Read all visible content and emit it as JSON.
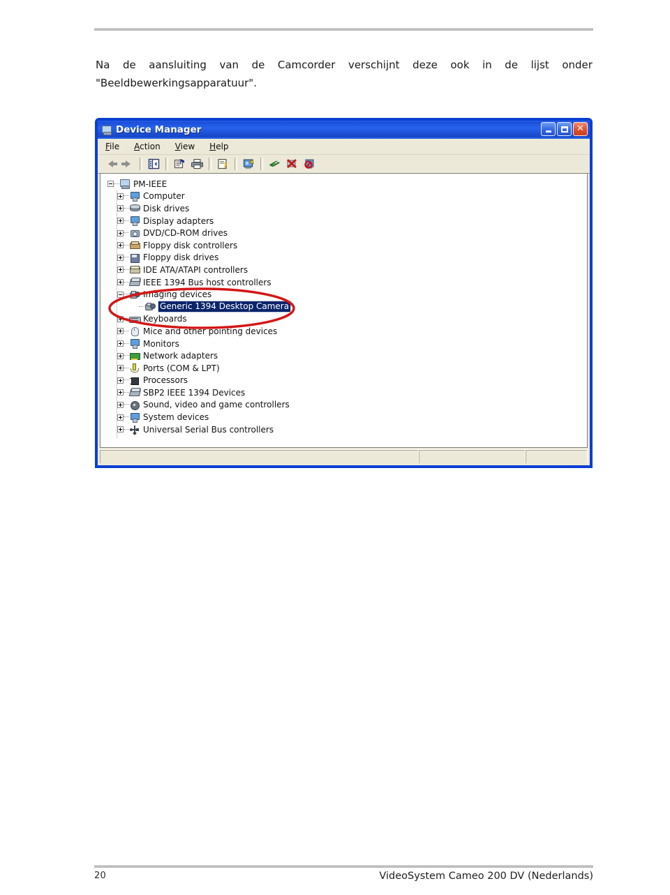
{
  "document": {
    "intro_line1_words": [
      "Na",
      "de",
      "aansluiting",
      "van",
      "de",
      "Camcorder",
      "verschijnt",
      "deze",
      "ook",
      "in",
      "de",
      "lijst",
      "onder"
    ],
    "intro_line2": "\"Beeldbewerkingsapparatuur\".",
    "footer_page_number": "20",
    "footer_title": "VideoSystem Cameo 200 DV (Nederlands)"
  },
  "window": {
    "title": "Device Manager",
    "buttons": {
      "minimize": "_",
      "maximize": "□",
      "close": "✕"
    },
    "menu": [
      {
        "pre": "",
        "accel": "F",
        "post": "ile"
      },
      {
        "pre": "",
        "accel": "A",
        "post": "ction"
      },
      {
        "pre": "",
        "accel": "V",
        "post": "iew"
      },
      {
        "pre": "",
        "accel": "H",
        "post": "elp"
      }
    ],
    "toolbar": [
      {
        "name": "back-button",
        "icon": "arrow-left"
      },
      {
        "name": "forward-button",
        "icon": "arrow-right"
      },
      {
        "name": "show-hide-console-tree-button",
        "icon": "console-tree"
      },
      {
        "name": "properties-button",
        "icon": "properties"
      },
      {
        "name": "print-button",
        "icon": "printer"
      },
      {
        "name": "help-button",
        "icon": "help"
      },
      {
        "name": "scan-for-hardware-changes-button",
        "icon": "scan-hardware"
      },
      {
        "name": "update-driver-button",
        "icon": "update-driver"
      },
      {
        "name": "uninstall-button",
        "icon": "uninstall"
      },
      {
        "name": "disable-button",
        "icon": "disable"
      }
    ],
    "statusbar": {
      "panel1": "",
      "panel2": "",
      "panel3": ""
    }
  },
  "tree": {
    "root": {
      "label": "PM-IEEE",
      "icon": "computer-icon",
      "state": "expanded"
    },
    "nodes": [
      {
        "label": "Computer",
        "icon": "monitor-icon",
        "state": "collapsed",
        "level": 1
      },
      {
        "label": "Disk drives",
        "icon": "disk-icon",
        "state": "collapsed",
        "level": 1
      },
      {
        "label": "Display adapters",
        "icon": "monitor-icon",
        "state": "collapsed",
        "level": 1
      },
      {
        "label": "DVD/CD-ROM drives",
        "icon": "cdrom-icon",
        "state": "collapsed",
        "level": 1
      },
      {
        "label": "Floppy disk controllers",
        "icon": "floppy-controller-icon",
        "state": "collapsed",
        "level": 1
      },
      {
        "label": "Floppy disk drives",
        "icon": "floppy-drive-icon",
        "state": "collapsed",
        "level": 1
      },
      {
        "label": "IDE ATA/ATAPI controllers",
        "icon": "ide-controller-icon",
        "state": "collapsed",
        "level": 1
      },
      {
        "label": "IEEE 1394 Bus host controllers",
        "icon": "firewire-icon",
        "state": "collapsed",
        "level": 1
      },
      {
        "label": "Imaging devices",
        "icon": "camera-icon",
        "state": "expanded",
        "level": 1
      },
      {
        "label": "Generic 1394 Desktop Camera",
        "icon": "camera-icon",
        "state": "leaf",
        "level": 2,
        "selected": true
      },
      {
        "label": "Keyboards",
        "icon": "keyboard-icon",
        "state": "collapsed",
        "level": 1
      },
      {
        "label": "Mice and other pointing devices",
        "icon": "mouse-icon",
        "state": "collapsed",
        "level": 1
      },
      {
        "label": "Monitors",
        "icon": "monitor-icon",
        "state": "collapsed",
        "level": 1
      },
      {
        "label": "Network adapters",
        "icon": "network-icon",
        "state": "collapsed",
        "level": 1
      },
      {
        "label": "Ports (COM & LPT)",
        "icon": "port-icon",
        "state": "collapsed",
        "level": 1
      },
      {
        "label": "Processors",
        "icon": "cpu-icon",
        "state": "collapsed",
        "level": 1
      },
      {
        "label": "SBP2 IEEE 1394 Devices",
        "icon": "firewire-icon",
        "state": "collapsed",
        "level": 1
      },
      {
        "label": "Sound, video and game controllers",
        "icon": "sound-icon",
        "state": "collapsed",
        "level": 1
      },
      {
        "label": "System devices",
        "icon": "monitor-icon",
        "state": "collapsed",
        "level": 1
      },
      {
        "label": "Universal Serial Bus controllers",
        "icon": "usb-icon",
        "state": "collapsed",
        "level": 1
      }
    ]
  },
  "annotation": {
    "shape": "ellipse",
    "color": "#d41616",
    "targets": [
      "Imaging devices",
      "Generic 1394 Desktop Camera"
    ]
  },
  "colors": {
    "titlebar_blue": "#1b4fd8",
    "window_border": "#0a3fd4",
    "selection_blue": "#0a246a",
    "chrome_beige": "#ece9d8",
    "annotation_red": "#d41616"
  }
}
